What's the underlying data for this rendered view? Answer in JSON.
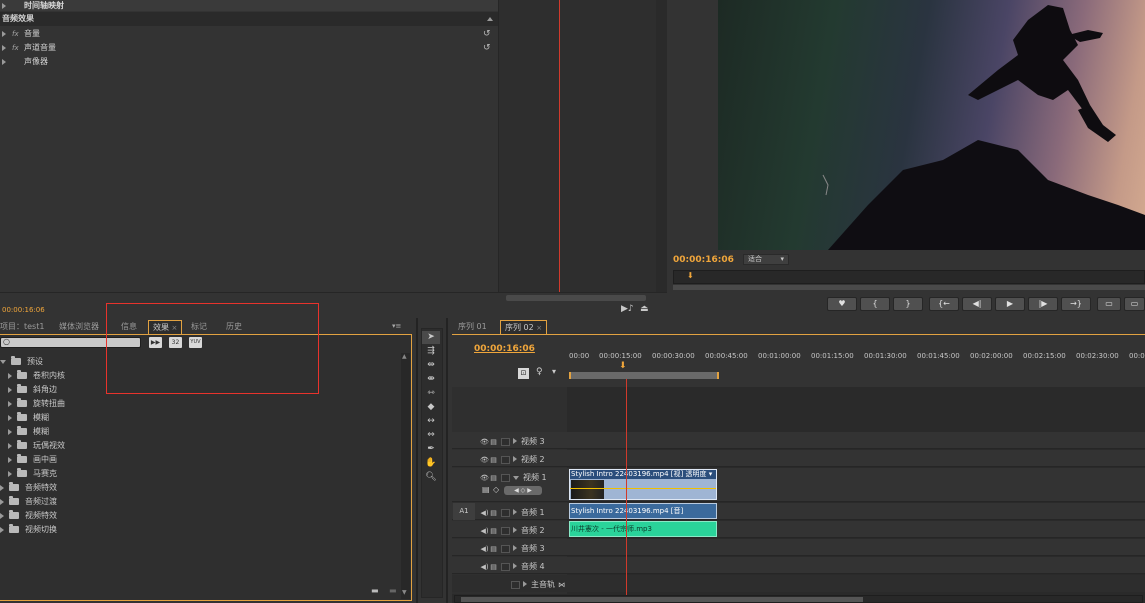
{
  "effect_controls": {
    "items": [
      {
        "label": "时间轴映射",
        "kind": "property"
      },
      {
        "label": "音频效果",
        "kind": "header"
      },
      {
        "label": "音量",
        "kind": "effect"
      },
      {
        "label": "声道音量",
        "kind": "effect"
      },
      {
        "label": "声像器",
        "kind": "plain"
      }
    ],
    "timecode": "00:00:16:06"
  },
  "program_monitor": {
    "timecode": "00:00:16:06",
    "fit_dropdown": "适合"
  },
  "effects_panel": {
    "tabs": [
      "项目：test1",
      "媒体浏览器",
      "信息",
      "效果",
      "标记",
      "历史"
    ],
    "active_tab_index": 3,
    "search_placeholder": "",
    "filter_buttons": [
      "▶▶",
      "32",
      "YUV"
    ],
    "tree": [
      {
        "label": "预设",
        "level": 0,
        "expanded": true
      },
      {
        "label": "卷积内核",
        "level": 1
      },
      {
        "label": "斜角边",
        "level": 1
      },
      {
        "label": "旋转扭曲",
        "level": 1
      },
      {
        "label": "模糊",
        "level": 1
      },
      {
        "label": "模糊",
        "level": 1
      },
      {
        "label": "玩偶视效",
        "level": 1
      },
      {
        "label": "画中画",
        "level": 1
      },
      {
        "label": "马赛克",
        "level": 1
      },
      {
        "label": "音频特效",
        "level": 0
      },
      {
        "label": "音频过渡",
        "level": 0
      },
      {
        "label": "视频特效",
        "level": 0
      },
      {
        "label": "视频切换",
        "level": 0
      }
    ]
  },
  "timeline": {
    "tabs": [
      "序列 01",
      "序列 02"
    ],
    "active_tab_index": 1,
    "timecode": "00:00:16:06",
    "ruler_labels": [
      "00:00",
      "00:00:15:00",
      "00:00:30:00",
      "00:00:45:00",
      "00:01:00:00",
      "00:01:15:00",
      "00:01:30:00",
      "00:01:45:00",
      "00:02:00:00",
      "00:02:15:00",
      "00:02:30:00",
      "00:0"
    ],
    "source_track": "A1",
    "tracks": [
      {
        "name": "视频 3",
        "type": "video"
      },
      {
        "name": "视频 2",
        "type": "video"
      },
      {
        "name": "视频 1",
        "type": "video",
        "expanded": true
      },
      {
        "name": "音频 1",
        "type": "audio"
      },
      {
        "name": "音频 2",
        "type": "audio"
      },
      {
        "name": "音频 3",
        "type": "audio"
      },
      {
        "name": "音频 4",
        "type": "audio"
      },
      {
        "name": "主音轨",
        "type": "master"
      }
    ],
    "clips": {
      "video1": "Stylish Intro 22403196.mp4 [视] 透明度 ▾",
      "audio1": "Stylish Intro 22403196.mp4 [音]",
      "audio2": "川井憲次 - 一代宗师.mp3"
    }
  },
  "colors": {
    "accent": "#e2a241",
    "timecode": "#f0a63b",
    "playhead": "#d03a2c",
    "video_clip": "#9fb5d4",
    "audio_clip": "#3b6a9c",
    "music_clip": "#2ad39a",
    "highlight_box": "#e8332c"
  }
}
